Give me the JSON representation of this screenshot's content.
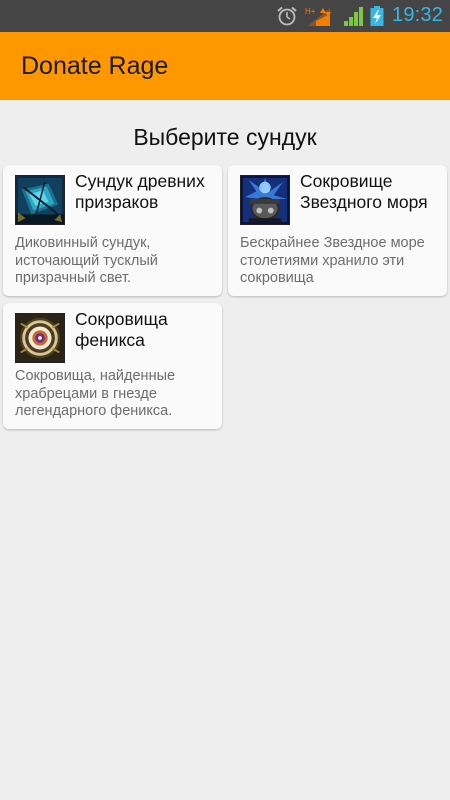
{
  "status_bar": {
    "time": "19:32",
    "network_label": "H+",
    "icons": [
      "alarm-icon",
      "mobile-data-icon",
      "signal-icon",
      "battery-charging-icon"
    ],
    "accent_color": "#38b6e6"
  },
  "action_bar": {
    "title": "Donate Rage",
    "color": "#ff9800"
  },
  "main": {
    "heading": "Выберите сундук",
    "chests": [
      {
        "name": "Сундук древних призраков",
        "description": "Диковинный сундук, источающий тусклый призрачный свет.",
        "icon": "ghost-chest-icon"
      },
      {
        "name": "Сокровище Звездного моря",
        "description": "Бескрайнее Звездное море столетиями хранило эти сокровища",
        "icon": "star-sea-treasure-icon"
      },
      {
        "name": "Сокровища феникса",
        "description": "Сокровища, найденные храбрецами в гнезде легендарного феникса.",
        "icon": "phoenix-treasure-icon"
      }
    ]
  }
}
